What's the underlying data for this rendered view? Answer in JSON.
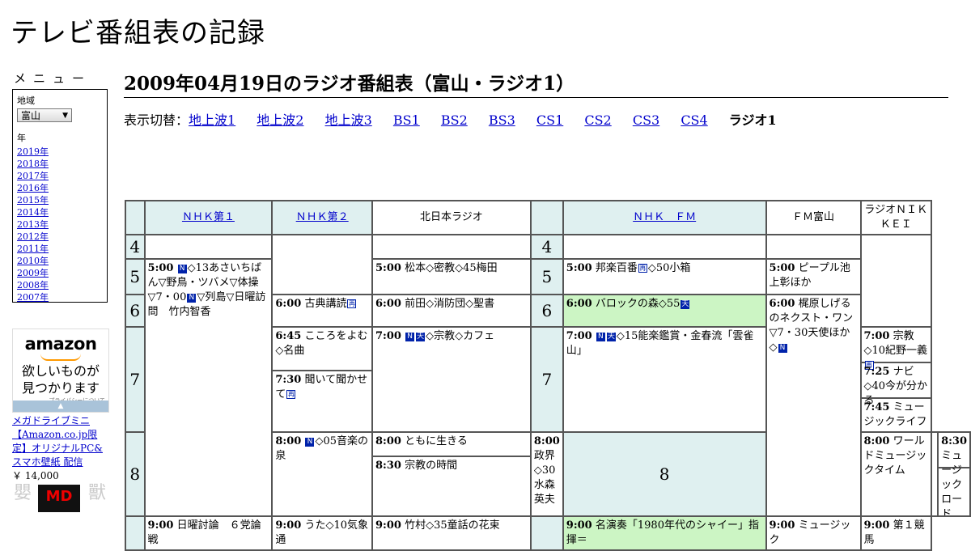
{
  "site": {
    "title": "テレビ番組表の記録"
  },
  "menu": {
    "heading": "メニュー",
    "region_label": "地域",
    "region_value": "富山",
    "year_label": "年",
    "years": [
      "2019年",
      "2018年",
      "2017年",
      "2016年",
      "2015年",
      "2014年",
      "2013年",
      "2012年",
      "2011年",
      "2010年",
      "2009年",
      "2008年",
      "2007年"
    ]
  },
  "ad": {
    "logo": "amazon",
    "tagline_1": "欲しいものが",
    "tagline_2": "見つかります",
    "privacy": "プライバシーについて"
  },
  "product": {
    "title": "メガドライブミニ【Amazon.co.jp限定】オリジナルPC&スマホ壁紙 配信",
    "price": "￥ 14,000",
    "logo_text": "MD"
  },
  "page": {
    "title": "2009年04月19日のラジオ番組表（富山・ラジオ1）"
  },
  "switcher": {
    "label": "表示切替：",
    "links": [
      "地上波1",
      "地上波2",
      "地上波3",
      "BS1",
      "BS2",
      "BS3",
      "CS1",
      "CS2",
      "CS3",
      "CS4"
    ],
    "current": "ラジオ1"
  },
  "icons": {
    "news": "N",
    "weather": "天",
    "rerun": "再"
  },
  "schedule": {
    "channels": {
      "nhk1": "ＮＨＫ第１",
      "nhk2": "ＮＨＫ第２",
      "kitanihon": "北日本ラジオ",
      "nhkfm": "ＮＨＫ　ＦＭ",
      "fmtoyama": "ＦＭ富山",
      "nikkei": "ラジオＮＩＫＫＥＩ"
    },
    "hours": {
      "h4": "4",
      "h5": "5",
      "h6": "6",
      "h7": "7",
      "h8": "8"
    },
    "programs": {
      "nhk1_500": {
        "time": "5:00",
        "a": "◇13あさいちばん▽野鳥・ツバメ▽体操▽7・00",
        "b": "▽列島▽日曜訪問　竹内智香"
      },
      "nhk1_800": {
        "time": "8:00",
        "text": "◇05音楽の泉"
      },
      "nhk1_900": {
        "time": "9:00",
        "text": "日曜討論　６党論戦"
      },
      "nhk2_600": {
        "time": "6:00",
        "text": "古典講読"
      },
      "nhk2_645": {
        "time": "6:45",
        "text": "こころをよむ◇名曲"
      },
      "nhk2_730": {
        "time": "7:30",
        "text": "聞いて聞かせて"
      },
      "nhk2_800": {
        "time": "8:00",
        "text": "ともに生きる"
      },
      "nhk2_830": {
        "time": "8:30",
        "text": "宗教の時間"
      },
      "nhk2_900": {
        "time": "9:00",
        "text": "うた◇10気象通"
      },
      "kn_500": {
        "time": "5:00",
        "text": "松本◇密教◇45梅田"
      },
      "kn_600": {
        "time": "6:00",
        "text": "前田◇消防団◇聖書"
      },
      "kn_700": {
        "time": "7:00",
        "text": "◇宗教◇カフェ"
      },
      "kn_800": {
        "time": "8:00",
        "text": "政界◇30水森英夫"
      },
      "kn_900": {
        "time": "9:00",
        "text": "竹村◇35童話の花束"
      },
      "fm_500": {
        "time": "5:00",
        "text": "邦楽百番",
        "after": "◇50小箱"
      },
      "fm_600": {
        "time": "6:00",
        "text": "バロックの森◇55"
      },
      "fm_700": {
        "time": "7:00",
        "text": "◇15能楽鑑賞・金春流「雲雀山」"
      },
      "fm_800": {
        "time": "8:00",
        "text": "ワールドミュージックタイム"
      },
      "fm_900": {
        "time": "9:00",
        "text": "名演奏「1980年代のシャイー」指揮＝"
      },
      "ft_500": {
        "time": "5:00",
        "text": "ピープル池上彰ほか"
      },
      "ft_600": {
        "time": "6:00",
        "text": "梶原しげるのネクスト・ワン▽7・30天使ほか◇"
      },
      "ft_900": {
        "time": "9:00",
        "text": "ミュージック"
      },
      "nk_700": {
        "time": "7:00",
        "text": "宗教◇10紀野一義"
      },
      "nk_725": {
        "time": "7:25",
        "text": "ナビ◇40今が分かる"
      },
      "nk_745": {
        "time": "7:45",
        "text": "ミュージックライフ"
      },
      "nk_830": {
        "time": "8:30",
        "text": "ミュージックロード"
      },
      "nk_900": {
        "time": "9:00",
        "text": "第１競馬"
      }
    }
  }
}
